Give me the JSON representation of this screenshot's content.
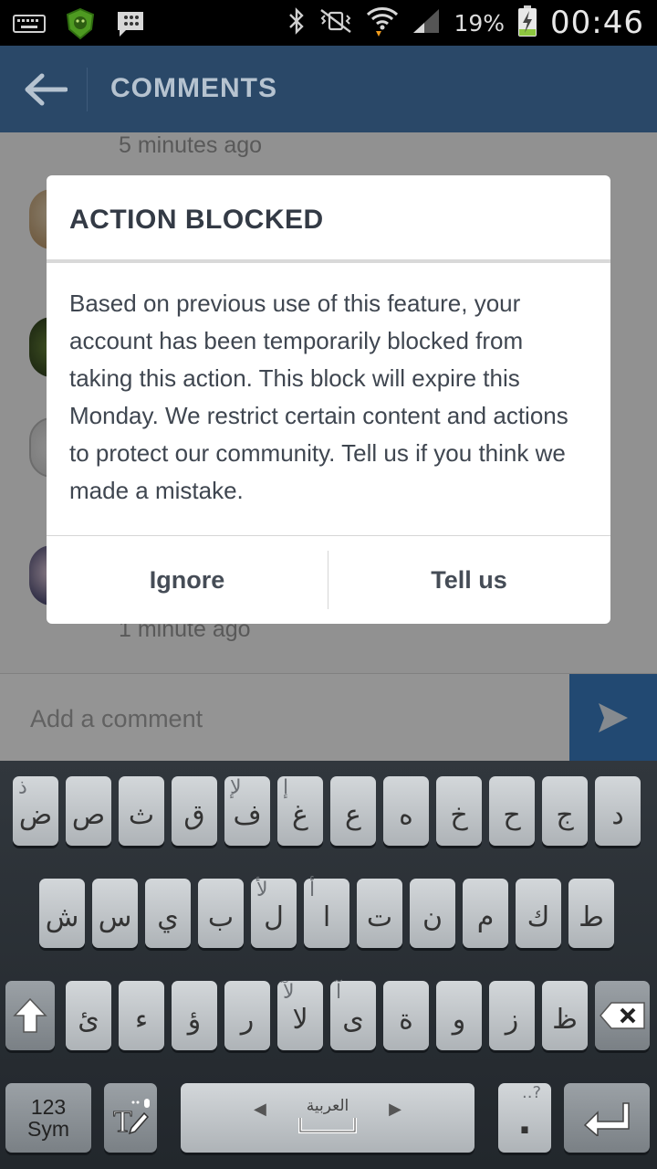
{
  "status_bar": {
    "battery": "19%",
    "clock": "00:46",
    "icons": [
      "keyboard-icon",
      "shield-app-icon",
      "bbm-icon",
      "bluetooth-icon",
      "vibrate-mute-icon",
      "wifi-icon",
      "signal-icon",
      "battery-charging-icon"
    ]
  },
  "header": {
    "title": "COMMENTS"
  },
  "comments": {
    "top_time": "5 minutes ago",
    "bottom_time": "1 minute ago"
  },
  "comment_bar": {
    "placeholder": "Add a comment"
  },
  "dialog": {
    "title": "ACTION BLOCKED",
    "body": "Based on previous use of this feature, your account has been temporarily blocked from taking this action. This block will expire this Monday. We restrict certain content and actions to protect our community. Tell us if you think we made a mistake.",
    "ignore_label": "Ignore",
    "tell_us_label": "Tell us"
  },
  "keyboard": {
    "row1": [
      {
        "main": "ض",
        "hint": "ذ"
      },
      {
        "main": "ص",
        "hint": ""
      },
      {
        "main": "ث",
        "hint": ""
      },
      {
        "main": "ق",
        "hint": ""
      },
      {
        "main": "ف",
        "hint": "لإ"
      },
      {
        "main": "غ",
        "hint": "إ"
      },
      {
        "main": "ع",
        "hint": ""
      },
      {
        "main": "ه",
        "hint": ""
      },
      {
        "main": "خ",
        "hint": ""
      },
      {
        "main": "ح",
        "hint": ""
      },
      {
        "main": "ج",
        "hint": ""
      },
      {
        "main": "د",
        "hint": ""
      }
    ],
    "row2": [
      {
        "main": "ش",
        "hint": ""
      },
      {
        "main": "س",
        "hint": ""
      },
      {
        "main": "ي",
        "hint": ""
      },
      {
        "main": "ب",
        "hint": ""
      },
      {
        "main": "ل",
        "hint": "لأ"
      },
      {
        "main": "ا",
        "hint": "أ"
      },
      {
        "main": "ت",
        "hint": ""
      },
      {
        "main": "ن",
        "hint": ""
      },
      {
        "main": "م",
        "hint": ""
      },
      {
        "main": "ك",
        "hint": ""
      },
      {
        "main": "ط",
        "hint": ""
      }
    ],
    "row3": [
      {
        "main": "ئ",
        "hint": ""
      },
      {
        "main": "ء",
        "hint": ""
      },
      {
        "main": "ؤ",
        "hint": ""
      },
      {
        "main": "ر",
        "hint": ""
      },
      {
        "main": "لا",
        "hint": "لآ"
      },
      {
        "main": "ى",
        "hint": "آ"
      },
      {
        "main": "ة",
        "hint": ""
      },
      {
        "main": "و",
        "hint": ""
      },
      {
        "main": "ز",
        "hint": ""
      },
      {
        "main": "ظ",
        "hint": ""
      }
    ],
    "sym_label_1": "123",
    "sym_label_2": "Sym",
    "language_label": "العربية",
    "period_label": ".",
    "period_hint": "..?"
  },
  "colors": {
    "header_bg": "#2a4868",
    "send_bg": "#3b7fc4",
    "dialog_text": "#3f4650"
  }
}
